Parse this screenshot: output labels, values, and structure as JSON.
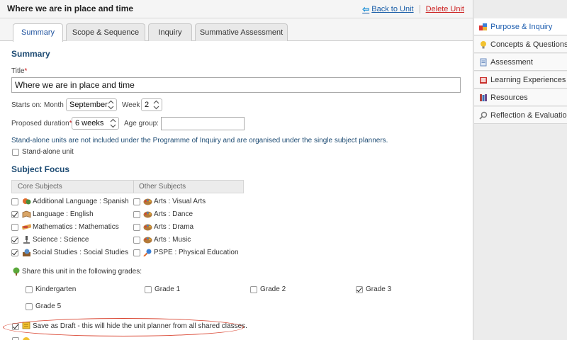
{
  "header": {
    "title": "Where we are in place and time",
    "back_label": "Back to Unit",
    "delete_label": "Delete Unit"
  },
  "tabs": [
    {
      "label": "Summary",
      "active": true
    },
    {
      "label": "Scope & Sequence",
      "active": false
    },
    {
      "label": "Inquiry",
      "active": false
    },
    {
      "label": "Summative Assessment",
      "active": false
    }
  ],
  "sidebar": {
    "items": [
      {
        "label": "Purpose & Inquiry",
        "icon": "puzzle-icon",
        "active": true
      },
      {
        "label": "Concepts & Questions",
        "icon": "lightbulb-icon",
        "active": false
      },
      {
        "label": "Assessment",
        "icon": "document-icon",
        "active": false
      },
      {
        "label": "Learning Experiences",
        "icon": "book-icon",
        "active": false
      },
      {
        "label": "Resources",
        "icon": "books-icon",
        "active": false
      },
      {
        "label": "Reflection & Evaluation",
        "icon": "magnifier-icon",
        "active": false
      }
    ]
  },
  "summary": {
    "heading": "Summary",
    "title_label": "Title",
    "title_value": "Where we are in place and time",
    "starts_on_label": "Starts on:",
    "month_label": "Month",
    "month_value": "September",
    "week_label": "Week",
    "week_value": "2",
    "duration_label": "Proposed duration",
    "duration_value": "6 weeks",
    "age_group_label": "Age group:",
    "age_group_value": "",
    "standalone_note": "Stand-alone units are not included under the Programme of Inquiry and are organised under the single subject planners.",
    "standalone_label": "Stand-alone unit",
    "standalone_checked": false
  },
  "subject_focus": {
    "heading": "Subject Focus",
    "core_header": "Core Subjects",
    "other_header": "Other Subjects",
    "core": [
      {
        "label": "Additional Language : Spanish",
        "checked": false,
        "icon": "language-icon"
      },
      {
        "label": "Language : English",
        "checked": true,
        "icon": "book-icon"
      },
      {
        "label": "Mathematics : Mathematics",
        "checked": false,
        "icon": "ruler-icon"
      },
      {
        "label": "Science : Science",
        "checked": true,
        "icon": "microscope-icon"
      },
      {
        "label": "Social Studies : Social Studies",
        "checked": true,
        "icon": "globe-books-icon"
      }
    ],
    "other": [
      {
        "label": "Arts : Visual Arts",
        "checked": false,
        "icon": "palette-icon"
      },
      {
        "label": "Arts : Dance",
        "checked": false,
        "icon": "palette-icon"
      },
      {
        "label": "Arts : Drama",
        "checked": false,
        "icon": "palette-icon"
      },
      {
        "label": "Arts : Music",
        "checked": false,
        "icon": "palette-icon"
      },
      {
        "label": "PSPE : Physical Education",
        "checked": false,
        "icon": "racket-icon"
      }
    ]
  },
  "share": {
    "label": "Share this unit in the following grades:",
    "grades": [
      {
        "label": "Kindergarten",
        "checked": false
      },
      {
        "label": "Grade 1",
        "checked": false
      },
      {
        "label": "Grade 2",
        "checked": false
      },
      {
        "label": "Grade 3",
        "checked": true
      },
      {
        "label": "Grade 5",
        "checked": false
      }
    ]
  },
  "draft": {
    "label": "Save as Draft - this will hide the unit planner from all shared classes.",
    "checked": true
  },
  "colors": {
    "heading": "#1d4b73",
    "link": "#1a5ea8",
    "danger": "#cc2222",
    "highlight_ellipse": "#d9432f"
  }
}
